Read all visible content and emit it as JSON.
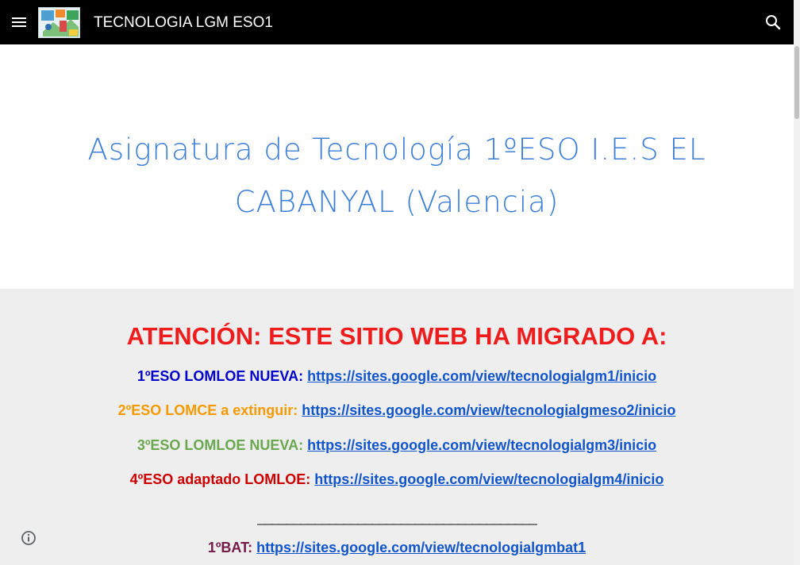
{
  "header": {
    "site_title": "TECNOLOGIA LGM ESO1"
  },
  "hero": {
    "title": "Asignatura de Tecnología 1ºESO I.E.S EL CABANYAL (Valencia)"
  },
  "content": {
    "announcement": "ATENCIÓN: ESTE SITIO WEB HA MIGRADO A:",
    "links": [
      {
        "label": "1ºESO LOMLOE NUEVA: ",
        "url": "https://sites.google.com/view/tecnologialgm1/inicio",
        "color": "#0000cc"
      },
      {
        "label": "2ºESO LOMCE  a extinguir: ",
        "url": "https://sites.google.com/view/tecnologialgmeso2/inicio",
        "color": "#f59b00"
      },
      {
        "label": "3ºESO LOMLOE NUEVA: ",
        "url": "https://sites.google.com/view/tecnologialgm3/inicio",
        "color": "#6aa84f"
      },
      {
        "label": "4ºESO adaptado LOMLOE: ",
        "url": "https://sites.google.com/view/tecnologialgm4/inicio",
        "color": "#cc0000"
      }
    ],
    "separator": "_______________________________________",
    "bat": {
      "label": "1ºBAT: ",
      "url": "https://sites.google.com/view/tecnologialgmbat1",
      "color": "#741b47"
    }
  },
  "colors": {
    "topbar": "#000000",
    "hero_title": "#3d7fd8",
    "announcement": "#ee1c1c",
    "link": "#1155cc",
    "content_bg": "#eeeeee"
  },
  "icons": [
    "menu-icon",
    "search-icon",
    "info-icon"
  ]
}
